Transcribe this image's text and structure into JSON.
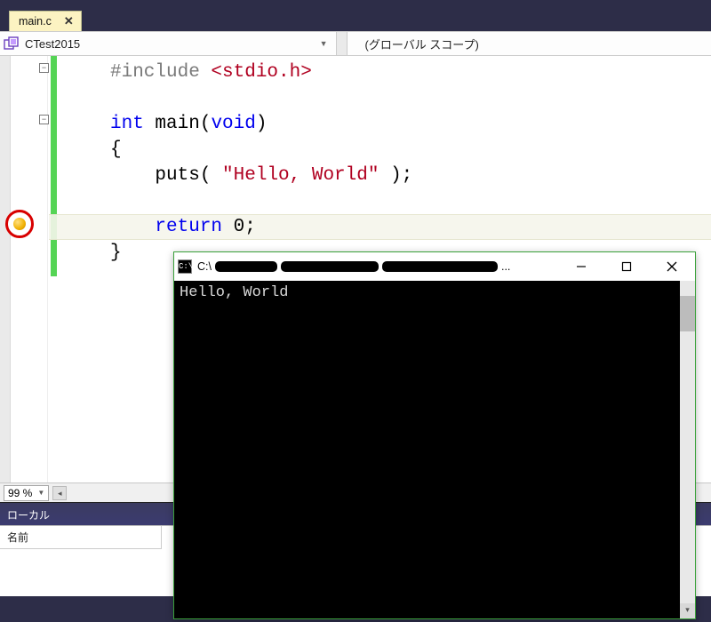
{
  "tab": {
    "filename": "main.c"
  },
  "navbar": {
    "project": "CTest2015",
    "scope": "(グローバル スコープ)"
  },
  "editor": {
    "zoom": "99 %",
    "code": {
      "include_kw": "#include ",
      "include_hdr": "<stdio.h>",
      "int_kw": "int",
      "main_id": " main(",
      "void_kw": "void",
      "main_close": ")",
      "brace_open": "{",
      "puts_call": "    puts( ",
      "puts_str": "\"Hello, World\"",
      "puts_end": " );",
      "return_kw": "return",
      "return_val": " 0;",
      "brace_close": "}"
    }
  },
  "locals_panel": {
    "title": "ローカル",
    "col1": "名前"
  },
  "console": {
    "title_prefix": "C:\\",
    "title_ellipsis": "...",
    "output": "Hello, World"
  }
}
